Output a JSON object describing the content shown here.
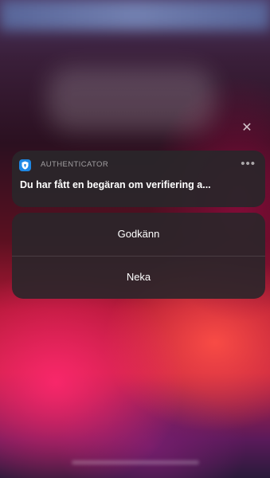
{
  "lockscreen": {
    "close_icon": "close-icon",
    "close_glyph": "✕"
  },
  "notification": {
    "app_icon": "shield-icon",
    "app_icon_color": "#1e88e5",
    "app_name": "AUTHENTICATOR",
    "more_glyph": "•••",
    "message": "Du har fått en begäran om verifiering a..."
  },
  "actions": {
    "approve_label": "Godkänn",
    "deny_label": "Neka"
  }
}
